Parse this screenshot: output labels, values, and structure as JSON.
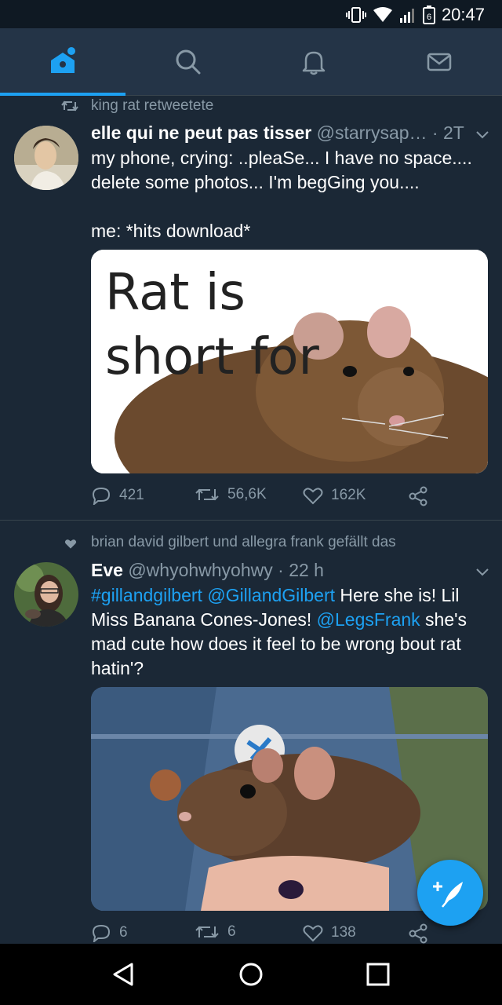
{
  "status_bar": {
    "time": "20:47",
    "battery_level": "6"
  },
  "nav": {
    "tabs": [
      {
        "name": "home-tab",
        "icon": "home-icon",
        "active": true
      },
      {
        "name": "search-tab",
        "icon": "search-icon",
        "active": false
      },
      {
        "name": "notifications-tab",
        "icon": "bell-icon",
        "active": false
      },
      {
        "name": "messages-tab",
        "icon": "mail-icon",
        "active": false
      }
    ],
    "accent_color": "#1da1f2"
  },
  "tweets": [
    {
      "social_context": "king rat retweetete",
      "social_icon": "retweet-icon",
      "author_name": "elle qui ne peut pas tisser",
      "author_handle": "@starrysap…",
      "time": "· 2T",
      "text_line1": "my phone, crying: ..pleaSe... I have no space....",
      "text_line2": "delete some photos... I'm begGing you....",
      "text_line3": "me: *hits download*",
      "media_caption": "Rat is short for",
      "replies": "421",
      "retweets": "56,6K",
      "likes": "162K"
    },
    {
      "social_context": "brian david gilbert und allegra frank gefällt das",
      "social_icon": "heart-icon",
      "author_name": "Eve",
      "author_handle": "@whyohwhyohwy",
      "time": "· 22 h",
      "hashtag": "#gillandgilbert",
      "mention1": "@GillandGilbert",
      "text_a": " Here she is! Lil Miss Banana Cones-Jones! ",
      "mention2": "@LegsFrank",
      "text_b": " she's mad cute how does it feel to be wrong bout rat hatin'?",
      "replies": "6",
      "retweets": "6",
      "likes": "138"
    }
  ],
  "fab": {
    "icon": "compose-tweet-icon"
  },
  "system_nav": [
    "back-icon",
    "home-circle-icon",
    "recents-icon"
  ]
}
